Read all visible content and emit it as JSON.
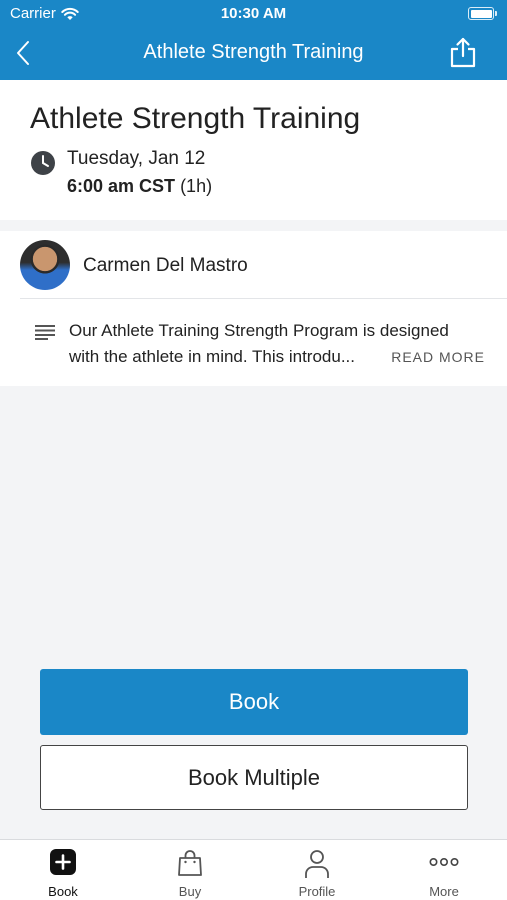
{
  "status_bar": {
    "carrier": "Carrier",
    "time": "10:30 AM"
  },
  "nav": {
    "title": "Athlete Strength Training",
    "back_icon": "chevron-left-icon",
    "share_icon": "share-icon"
  },
  "class_info": {
    "title": "Athlete Strength Training",
    "date": "Tuesday, Jan 12",
    "time": "6:00 am CST",
    "duration": "(1h)"
  },
  "instructor": {
    "name": "Carmen Del Mastro"
  },
  "description": {
    "line1": "Our Athlete Training Strength Program is designed",
    "line2": "with the athlete in mind. This introdu...",
    "read_more": "READ MORE"
  },
  "actions": {
    "book": "Book",
    "book_multiple": "Book Multiple"
  },
  "tabbar": {
    "items": [
      {
        "label": "Book",
        "icon": "plus-square-icon"
      },
      {
        "label": "Buy",
        "icon": "shopping-bag-icon"
      },
      {
        "label": "Profile",
        "icon": "person-icon"
      },
      {
        "label": "More",
        "icon": "more-dots-icon"
      }
    ],
    "active_index": 0
  },
  "colors": {
    "accent": "#1a87c7",
    "background": "#f3f4f6"
  }
}
